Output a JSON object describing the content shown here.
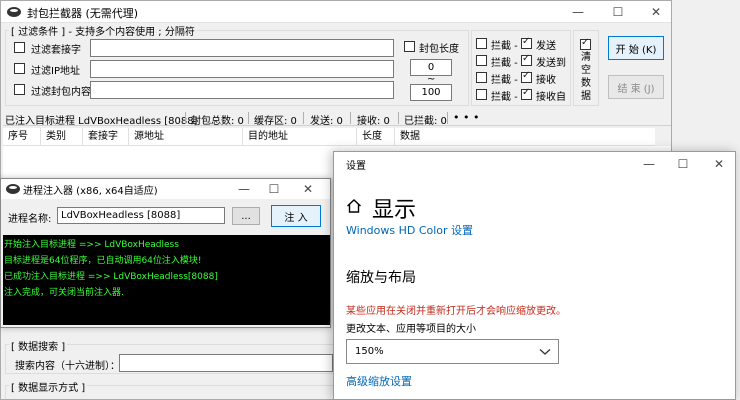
{
  "main": {
    "title": "封包拦截器 (无需代理)",
    "filter": {
      "label": "[ 过滤条件 ] - 支持多个内容使用 ; 分隔符",
      "rows": [
        {
          "label": "过滤套接字"
        },
        {
          "label": "过滤IP地址"
        },
        {
          "label": "过滤封包内容"
        }
      ],
      "length_label": "封包长度",
      "length_min": "0",
      "length_sep": "~",
      "length_max": "100"
    },
    "intercept": [
      {
        "intercept": "拦截 -",
        "action": "发送"
      },
      {
        "intercept": "拦截 -",
        "action": "发送到"
      },
      {
        "intercept": "拦截 -",
        "action": "接收"
      },
      {
        "intercept": "拦截 -",
        "action": "接收自"
      }
    ],
    "clear_data": "清空数据",
    "start_button": "开 始 (K)",
    "end_button": "结 束 (J)",
    "status": {
      "process": "已注入目标进程 LdVBoxHeadless [8088]",
      "total": "封包总数: 0",
      "cache": "缓存区: 0",
      "send": "发送: 0",
      "recv": "接收: 0",
      "intercepted": "已拦截: 0"
    },
    "columns": [
      "序号",
      "类别",
      "套接字",
      "源地址",
      "目的地址",
      "长度",
      "数据"
    ],
    "search": {
      "group": "[ 数据搜索 ]",
      "label": "搜索内容（十六进制）："
    },
    "display_group": "[ 数据显示方式 ]"
  },
  "injector": {
    "title": "进程注入器 (x86, x64自适应)",
    "process_label": "进程名称:",
    "process_value": "LdVBoxHeadless [8088]",
    "browse_label": "...",
    "inject_button": "注 入",
    "console": [
      "开始注入目标进程 =>> LdVBoxHeadless",
      "目标进程是64位程序，已自动调用64位注入模块!",
      "已成功注入目标进程 =>> LdVBoxHeadless[8088]",
      "注入完成，可关闭当前注入器."
    ]
  },
  "settings": {
    "title": "设置",
    "page_title": "显示",
    "hd_link": "Windows HD Color 设置",
    "section": "缩放与布局",
    "warning": "某些应用在关闭并重新打开后才会响应缩放更改。",
    "scale_label": "更改文本、应用等项目的大小",
    "scale_value": "150%",
    "advanced_link": "高级缩放设置"
  },
  "colors": {
    "accent": "#0078d7",
    "console_bg": "#000000",
    "console_text": "#3aff3a",
    "warning": "#c42b1c",
    "link": "#0067b8"
  }
}
